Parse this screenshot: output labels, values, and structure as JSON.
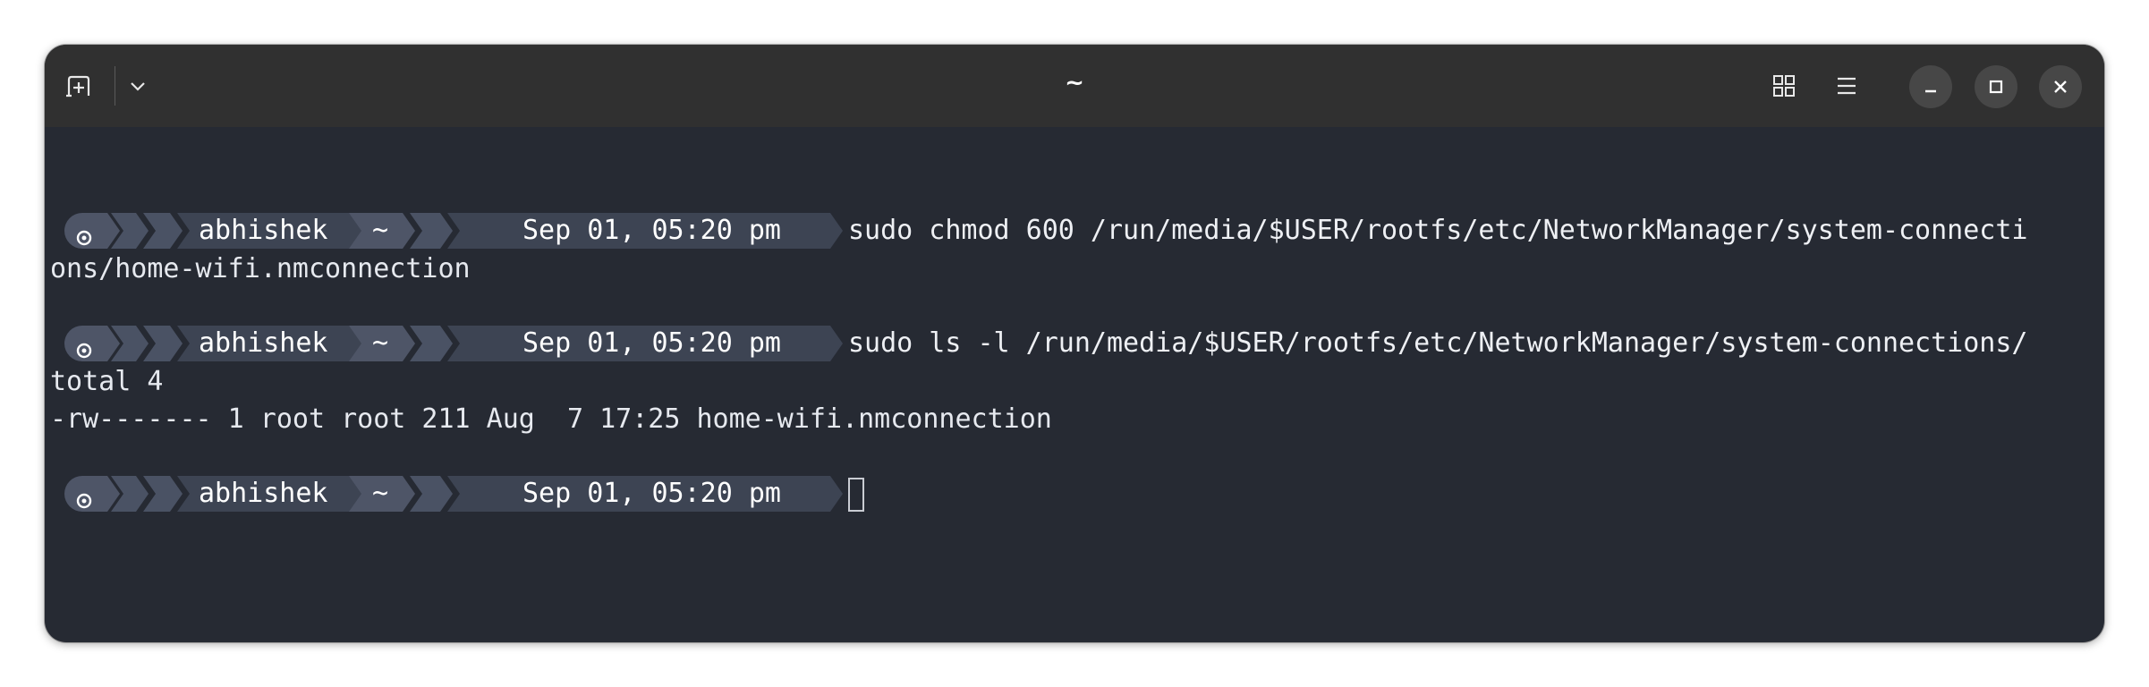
{
  "window": {
    "title": "~"
  },
  "titlebar": {
    "new_tab_icon": "new-tab-icon",
    "menu_dropdown_icon": "chevron-down-icon",
    "overview_icon": "grid-icon",
    "main_menu_icon": "hamburger-menu-icon",
    "minimize_icon": "minimize-icon",
    "maximize_icon": "maximize-icon",
    "close_icon": "close-icon"
  },
  "colors": {
    "terminal_bg": "#262a33",
    "titlebar_bg": "#303030",
    "prompt_segment_1": "#4e5567",
    "prompt_segment_2": "#3d4453",
    "prompt_chevron": "#4a5264"
  },
  "prompt": {
    "user": "abhishek",
    "dir": "~",
    "time": "Sep 01, 05:20 pm"
  },
  "terminal": {
    "cmd1": "sudo chmod 600 /run/media/$USER/rootfs/etc/NetworkManager/system-connecti",
    "cmd1_wrap": "ons/home-wifi.nmconnection",
    "cmd2": "sudo ls -l /run/media/$USER/rootfs/etc/NetworkManager/system-connections/",
    "out1": "total 4",
    "out2": "-rw------- 1 root root 211 Aug  7 17:25 home-wifi.nmconnection"
  }
}
